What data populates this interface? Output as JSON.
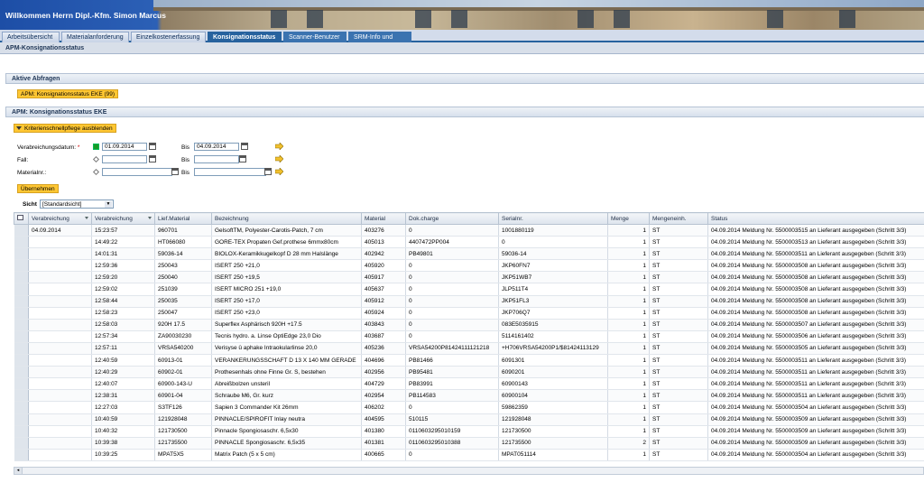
{
  "header": {
    "welcome": "Willkommen Herrn Dipl.-Kfm. Simon Marcus"
  },
  "tabs": [
    "Arbeitsübersicht",
    "Materialanforderung",
    "Einzelkostenerfassung",
    "Konsignationsstatus",
    "Scanner-Benutzer",
    "SRM-Info und Hilfe"
  ],
  "page_title": "APM-Konsignationsstatus",
  "queries": {
    "heading": "Aktive Abfragen",
    "item": "APM: Konsignationsstatus EKE (99)"
  },
  "report": {
    "heading": "APM: Konsignationsstatus EKE",
    "toggle": "Kriterienschnellpflege ausblenden"
  },
  "criteria": {
    "date_label": "Verabreichungsdatum:",
    "required_mark": "*",
    "date_from": "01.09.2014",
    "date_to": "04.09.2014",
    "fall_label": "Fall:",
    "material_label": "Materialnr.:",
    "bis": "Bis",
    "apply": "Übernehmen"
  },
  "view": {
    "label": "Sicht",
    "value": "[Standardsicht]"
  },
  "table": {
    "columns": [
      "Verabreichung",
      "Verabreichung",
      "Lief.Material",
      "Bezeichnung",
      "Material",
      "Dok.charge",
      "Serialnr.",
      "Menge",
      "Mengeneinh.",
      "Status"
    ],
    "first_date": "04.09.2014",
    "rows": [
      [
        "15:23:57",
        "960701",
        "GelsoftTM, Polyester-Carotis-Patch, 7 cm",
        "403276",
        "0",
        "1001880119",
        "1",
        "ST",
        "04.09.2014 Meldung Nr. 5500003515 an Lieferant ausgegeben (Schritt 3/3)"
      ],
      [
        "14:49:22",
        "HT066080",
        "GORE-TEX Propaten Gef.prothese 6mmx80cm",
        "405013",
        "4407472PP004",
        "0",
        "1",
        "ST",
        "04.09.2014 Meldung Nr. 5500003513 an Lieferant ausgegeben (Schritt 3/3)"
      ],
      [
        "14:01:31",
        "59036-14",
        "BIOLOX-Keramikkugelkopf D 28 mm Halslänge",
        "402942",
        "PB49801",
        "59036-14",
        "1",
        "ST",
        "04.09.2014 Meldung Nr. 5500003511 an Lieferant ausgegeben (Schritt 3/3)"
      ],
      [
        "12:59:36",
        "250043",
        "ISERT 250 +21,0",
        "405920",
        "0",
        "JKP60FN7",
        "1",
        "ST",
        "04.09.2014 Meldung Nr. 5500003508 an Lieferant ausgegeben (Schritt 3/3)"
      ],
      [
        "12:59:20",
        "250040",
        "ISERT 250 +19,5",
        "405917",
        "0",
        "JKP51WB7",
        "1",
        "ST",
        "04.09.2014 Meldung Nr. 5500003508 an Lieferant ausgegeben (Schritt 3/3)"
      ],
      [
        "12:59:02",
        "251039",
        "ISERT MICRO 251 +19,0",
        "405637",
        "0",
        "JLP511T4",
        "1",
        "ST",
        "04.09.2014 Meldung Nr. 5500003508 an Lieferant ausgegeben (Schritt 3/3)"
      ],
      [
        "12:58:44",
        "250035",
        "ISERT 250 +17,0",
        "405912",
        "0",
        "JKP51FL3",
        "1",
        "ST",
        "04.09.2014 Meldung Nr. 5500003508 an Lieferant ausgegeben (Schritt 3/3)"
      ],
      [
        "12:58:23",
        "250047",
        "ISERT 250 +23,0",
        "405924",
        "0",
        "JKP706Q7",
        "1",
        "ST",
        "04.09.2014 Meldung Nr. 5500003508 an Lieferant ausgegeben (Schritt 3/3)"
      ],
      [
        "12:58:03",
        "920H 17.5",
        "Superflex Asphärisch 920H +17.5",
        "403843",
        "0",
        "083E5035915",
        "1",
        "ST",
        "04.09.2014 Meldung Nr. 5500003507 an Lieferant ausgegeben (Schritt 3/3)"
      ],
      [
        "12:57:34",
        "ZA90030230",
        "Tecnis hydro. a. Linse OptiEdge 23,0 Dio",
        "403687",
        "0",
        "5114161402",
        "1",
        "ST",
        "04.09.2014 Meldung Nr. 5500003506 an Lieferant ausgegeben (Schritt 3/3)"
      ],
      [
        "12:57:11",
        "VRSA540200",
        "Verisyse û aphake Intraokularlinse 20,0",
        "405236",
        "VRSA54200P81424111121218",
        "+H706VRSA54200P1/$81424113129",
        "1",
        "ST",
        "04.09.2014 Meldung Nr. 5500003505 an Lieferant ausgegeben (Schritt 3/3)"
      ],
      [
        "12:40:59",
        "60913-01",
        "VERANKERUNGSSCHAFT D 13 X 140 MM GERADE",
        "404696",
        "PB81466",
        "6091301",
        "1",
        "ST",
        "04.09.2014 Meldung Nr. 5500003511 an Lieferant ausgegeben (Schritt 3/3)"
      ],
      [
        "12:40:29",
        "60902-01",
        "Prothesenhals ohne Finne Gr. S, bestehen",
        "402956",
        "PB95481",
        "6090201",
        "1",
        "ST",
        "04.09.2014 Meldung Nr. 5500003511 an Lieferant ausgegeben (Schritt 3/3)"
      ],
      [
        "12:40:07",
        "60900-143-U",
        "Abreißbolzen unsteril",
        "404729",
        "PB83991",
        "60900143",
        "1",
        "ST",
        "04.09.2014 Meldung Nr. 5500003511 an Lieferant ausgegeben (Schritt 3/3)"
      ],
      [
        "12:38:31",
        "60901-04",
        "Schraube M6, Gr. kurz",
        "402954",
        "PB114583",
        "60900104",
        "1",
        "ST",
        "04.09.2014 Meldung Nr. 5500003511 an Lieferant ausgegeben (Schritt 3/3)"
      ],
      [
        "12:27:03",
        "S3TF126",
        "Sapien 3 Commander Kit 26mm",
        "406202",
        "0",
        "59862359",
        "1",
        "ST",
        "04.09.2014 Meldung Nr. 5500003504 an Lieferant ausgegeben (Schritt 3/3)"
      ],
      [
        "10:40:59",
        "121928048",
        "PINNACLE/SPIROFIT Inlay neutra",
        "404595",
        "510115",
        "121928048",
        "1",
        "ST",
        "04.09.2014 Meldung Nr. 5500003509 an Lieferant ausgegeben (Schritt 3/3)"
      ],
      [
        "10:40:32",
        "121730500",
        "Pinnacle Spongiosaschr. 6,5x30",
        "401380",
        "0110603295010159",
        "121730500",
        "1",
        "ST",
        "04.09.2014 Meldung Nr. 5500003509 an Lieferant ausgegeben (Schritt 3/3)"
      ],
      [
        "10:39:38",
        "121735500",
        "PINNACLE Spongiosaschr. 6,5x35",
        "401381",
        "0110603295010388",
        "121735500",
        "2",
        "ST",
        "04.09.2014 Meldung Nr. 5500003509 an Lieferant ausgegeben (Schritt 3/3)"
      ],
      [
        "10:39:25",
        "MPAT5X5",
        "Matrix Patch (5 x 5 cm)",
        "400665",
        "0",
        "MPAT051114",
        "1",
        "ST",
        "04.09.2014 Meldung Nr. 5500003504 an Lieferant ausgegeben (Schritt 3/3)"
      ]
    ]
  }
}
